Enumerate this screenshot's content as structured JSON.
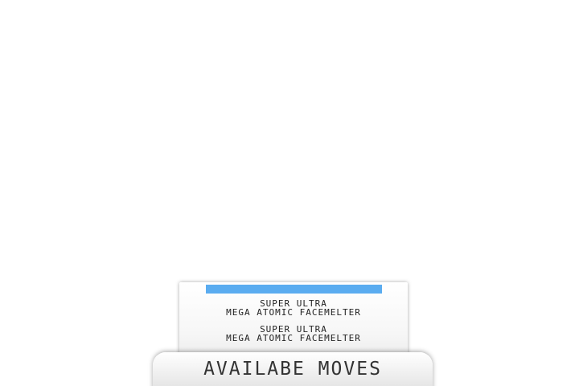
{
  "moves_panel": {
    "moves": [
      {
        "line1": "SUPER ULTRA",
        "line2": "MEGA ATOMIC FACEMELTER"
      },
      {
        "line1": "SUPER ULTRA",
        "line2": "MEGA ATOMIC FACEMELTER"
      }
    ],
    "selection_color": "#5aacf0"
  },
  "title_tab": {
    "label": "AVAILABE MOVES"
  }
}
